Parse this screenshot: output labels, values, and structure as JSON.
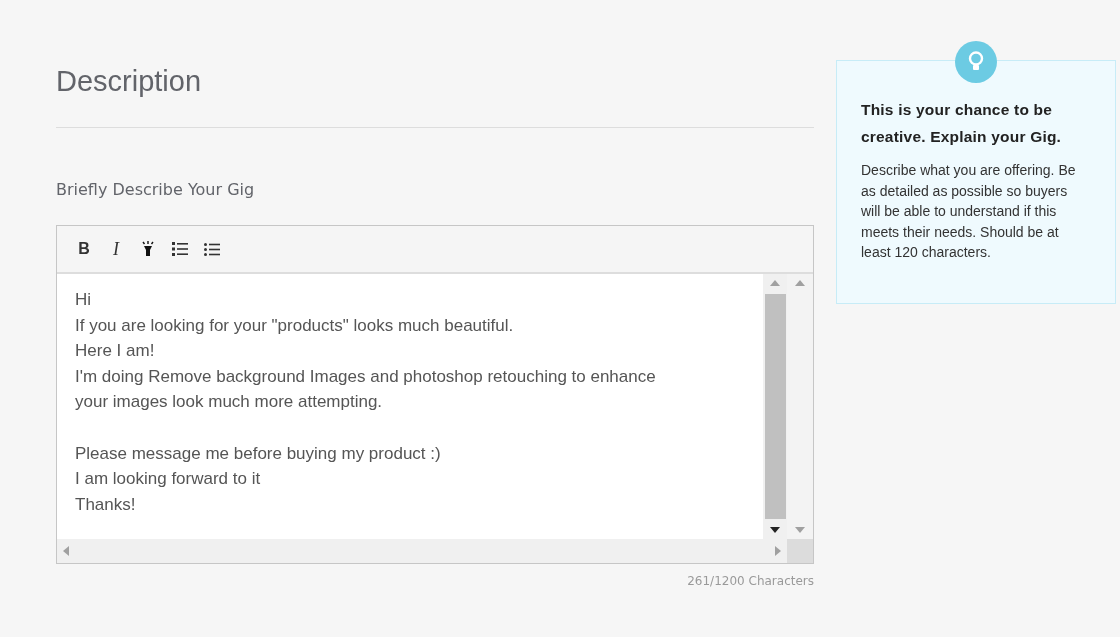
{
  "heading": "Description",
  "field_label": "Briefly Describe Your Gig",
  "toolbar": [
    {
      "kind": "bold",
      "label": "B"
    },
    {
      "kind": "italic",
      "label": "I"
    },
    {
      "kind": "highlight"
    },
    {
      "kind": "numbered-list"
    },
    {
      "kind": "bullet-list"
    }
  ],
  "editor_paragraphs": [
    [
      "Hi",
      "If you are looking for your \"products\" looks much beautiful.",
      "Here I am!",
      "I'm doing Remove background Images and photoshop retouching to enhance",
      "your images look much more attempting."
    ],
    [
      "Please message me before buying my product :)",
      "I am looking forward to it",
      "Thanks!"
    ]
  ],
  "char_count": "261/1200 Characters",
  "tip": {
    "title": "This is your chance to be creative. Explain your Gig.",
    "body": "Describe what you are offering. Be as detailed as possible so buyers will be able to understand if this meets their needs. Should be at least 120 characters."
  }
}
